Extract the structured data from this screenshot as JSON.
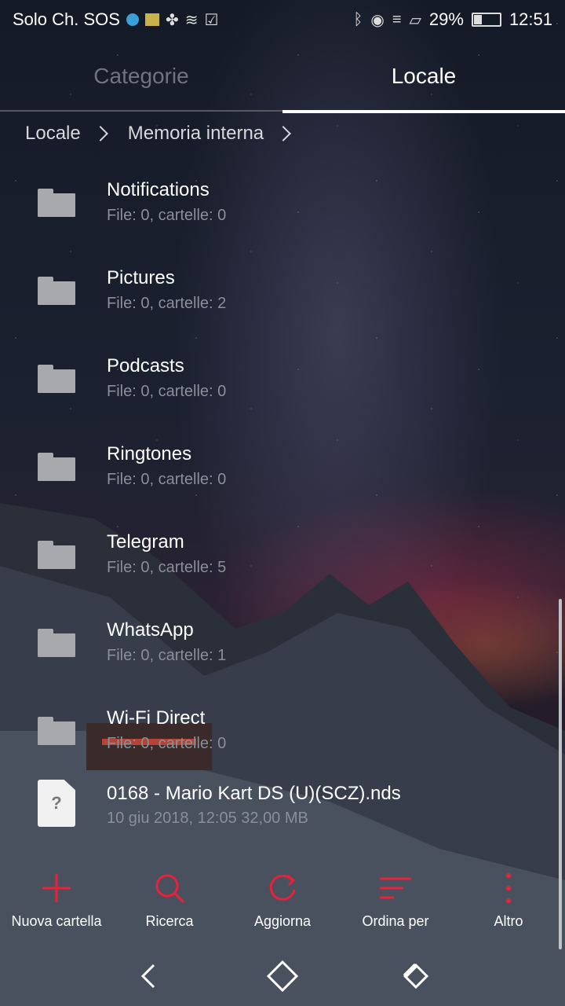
{
  "status_bar": {
    "carrier": "Solo Ch. SOS",
    "battery": "29%",
    "battery_level": 0.29,
    "time": "12:51",
    "icons": [
      "b-badge-icon",
      "sim-icon",
      "pinwheel-icon",
      "swirl-icon",
      "checkbox-icon",
      "bluetooth-icon",
      "eye-icon",
      "wifi-icon",
      "no-sim-icon",
      "battery-icon"
    ]
  },
  "tabs": [
    {
      "label": "Categorie",
      "active": false
    },
    {
      "label": "Locale",
      "active": true
    }
  ],
  "breadcrumb": [
    "Locale",
    "Memoria interna"
  ],
  "items": [
    {
      "type": "folder",
      "name": "Notifications",
      "meta": "File: 0, cartelle: 0"
    },
    {
      "type": "folder",
      "name": "Pictures",
      "meta": "File: 0, cartelle: 2"
    },
    {
      "type": "folder",
      "name": "Podcasts",
      "meta": "File: 0, cartelle: 0"
    },
    {
      "type": "folder",
      "name": "Ringtones",
      "meta": "File: 0, cartelle: 0"
    },
    {
      "type": "folder",
      "name": "Telegram",
      "meta": "File: 0, cartelle: 5"
    },
    {
      "type": "folder",
      "name": "WhatsApp",
      "meta": "File: 0, cartelle: 1"
    },
    {
      "type": "folder",
      "name": "Wi-Fi Direct",
      "meta": "File: 0, cartelle: 0"
    },
    {
      "type": "file",
      "name": "0168 - Mario Kart DS (U)(SCZ).nds",
      "meta": "10 giu 2018, 12:05 32,00 MB",
      "icon_glyph": "?"
    }
  ],
  "toolbar": [
    {
      "label": "Nuova cartella",
      "icon": "plus-icon"
    },
    {
      "label": "Ricerca",
      "icon": "search-icon"
    },
    {
      "label": "Aggiorna",
      "icon": "refresh-icon"
    },
    {
      "label": "Ordina per",
      "icon": "sort-icon"
    },
    {
      "label": "Altro",
      "icon": "more-icon"
    }
  ],
  "colors": {
    "accent": "#e8223a",
    "text_secondary": "#8a8f98",
    "tab_inactive": "#6f7480"
  },
  "nav": [
    "back-icon",
    "home-icon",
    "recents-icon"
  ]
}
